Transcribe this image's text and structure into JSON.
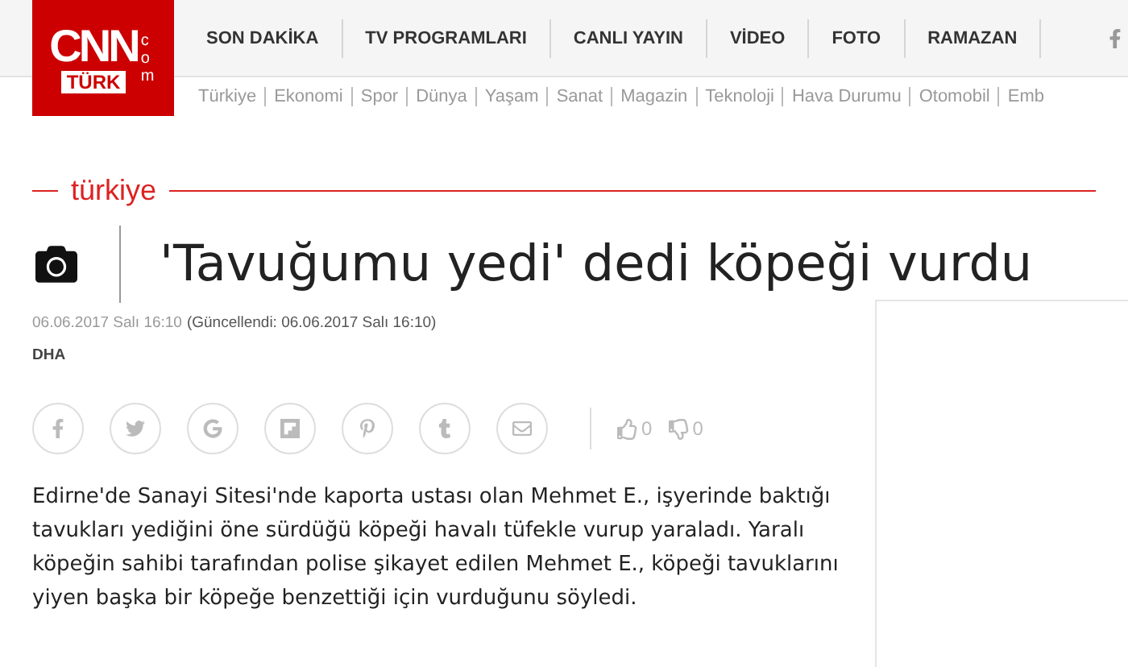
{
  "logo": {
    "main": "CNN",
    "sub": "TÜRK",
    "side": "com"
  },
  "nav": [
    "SON DAKİKA",
    "TV PROGRAMLARI",
    "CANLI YAYIN",
    "VİDEO",
    "FOTO",
    "RAMAZAN"
  ],
  "subnav": [
    "Türkiye",
    "Ekonomi",
    "Spor",
    "Dünya",
    "Yaşam",
    "Sanat",
    "Magazin",
    "Teknoloji",
    "Hava Durumu",
    "Otomobil",
    "Emb"
  ],
  "category": "türkiye",
  "title": "'Tavuğumu yedi' dedi köpeği vurdu",
  "date": "06.06.2017 Salı 16:10",
  "updated": "(Güncellendi: 06.06.2017 Salı 16:10)",
  "source": "DHA",
  "share": [
    {
      "kind": "facebook"
    },
    {
      "kind": "twitter"
    },
    {
      "kind": "google"
    },
    {
      "kind": "flipboard"
    },
    {
      "kind": "pinterest"
    },
    {
      "kind": "tumblr"
    },
    {
      "kind": "mail"
    }
  ],
  "likes": "0",
  "dislikes": "0",
  "body": "Edirne'de Sanayi Sitesi'nde kaporta ustası olan Mehmet E., işyerinde baktığı tavukları yediğini öne sürdüğü köpeği havalı tüfekle vurup yaraladı. Yaralı köpeğin sahibi tarafından polise şikayet edilen Mehmet E., köpeği tavuklarını yiyen başka bir köpeğe benzettiği için vurduğunu söyledi."
}
